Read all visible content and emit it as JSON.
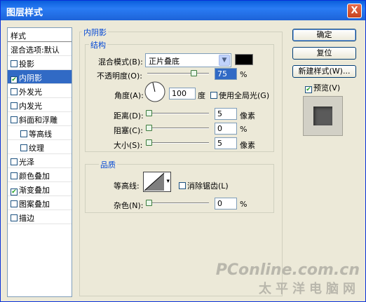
{
  "window": {
    "title": "图层样式",
    "close": "X"
  },
  "left_panel": {
    "header": "样式",
    "blend_options": "混合选项:默认",
    "items": [
      {
        "label": "投影",
        "checked": false
      },
      {
        "label": "内阴影",
        "checked": true
      },
      {
        "label": "外发光",
        "checked": false
      },
      {
        "label": "内发光",
        "checked": false
      },
      {
        "label": "斜面和浮雕",
        "checked": false
      },
      {
        "label": "等高线",
        "checked": false
      },
      {
        "label": "纹理",
        "checked": false
      },
      {
        "label": "光泽",
        "checked": false
      },
      {
        "label": "颜色叠加",
        "checked": false
      },
      {
        "label": "渐变叠加",
        "checked": true
      },
      {
        "label": "图案叠加",
        "checked": false
      },
      {
        "label": "描边",
        "checked": false
      }
    ]
  },
  "inner_shadow": {
    "group_title": "内阴影",
    "structure_title": "结构",
    "blend_mode_label": "混合模式(B):",
    "blend_mode_value": "正片叠底",
    "color": "#000000",
    "opacity_label": "不透明度(O):",
    "opacity_value": "75",
    "opacity_unit": "%",
    "angle_label": "角度(A):",
    "angle_value": "100",
    "angle_unit": "度",
    "global_light_label": "使用全局光(G)",
    "distance_label": "距离(D):",
    "distance_value": "5",
    "distance_unit": "像素",
    "choke_label": "阻塞(C):",
    "choke_value": "0",
    "choke_unit": "%",
    "size_label": "大小(S):",
    "size_value": "5",
    "size_unit": "像素"
  },
  "quality": {
    "title": "品质",
    "contour_label": "等高线:",
    "anti_alias_label": "消除锯齿(L)",
    "noise_label": "杂色(N):",
    "noise_value": "0",
    "noise_unit": "%"
  },
  "buttons": {
    "ok": "确定",
    "reset": "复位",
    "new_style": "新建样式(W)...",
    "preview": "预览(V)"
  },
  "watermark": {
    "line1": "PConline.com.cn",
    "line2": "太平洋电脑网"
  }
}
